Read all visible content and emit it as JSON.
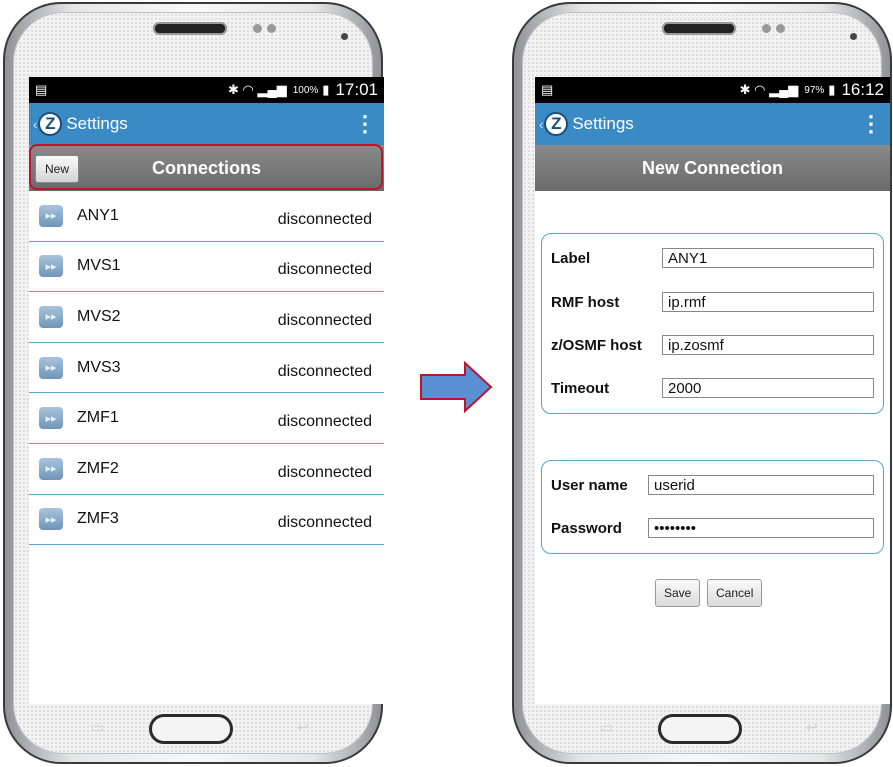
{
  "left_phone": {
    "status": {
      "battery": "100%",
      "time": "17:01"
    },
    "action_bar": {
      "title": "Settings"
    },
    "header": {
      "title": "Connections",
      "new_label": "New"
    },
    "connections": [
      {
        "label": "ANY1",
        "status": "disconnected"
      },
      {
        "label": "MVS1",
        "status": "disconnected"
      },
      {
        "label": "MVS2",
        "status": "disconnected"
      },
      {
        "label": "MVS3",
        "status": "disconnected"
      },
      {
        "label": "ZMF1",
        "status": "disconnected"
      },
      {
        "label": "ZMF2",
        "status": "disconnected"
      },
      {
        "label": "ZMF3",
        "status": "disconnected"
      }
    ]
  },
  "right_phone": {
    "status": {
      "battery": "97%",
      "time": "16:12"
    },
    "action_bar": {
      "title": "Settings"
    },
    "header": {
      "title": "New Connection"
    },
    "form": {
      "label_label": "Label",
      "label_value": "ANY1",
      "rmf_label": "RMF host",
      "rmf_value": "ip.rmf",
      "zosmf_label": "z/OSMF host",
      "zosmf_value": "ip.zosmf",
      "timeout_label": "Timeout",
      "timeout_value": "2000",
      "user_label": "User name",
      "user_value": "userid",
      "password_label": "Password",
      "password_value": "userpass"
    },
    "buttons": {
      "save": "Save",
      "cancel": "Cancel"
    }
  },
  "colors": {
    "action_bar": "#3a8bc5",
    "highlight": "#c0142a",
    "arrow_fill": "#5b8fd4",
    "arrow_stroke": "#c0142a"
  },
  "icons": [
    "back-chevron-icon",
    "z-logo-icon",
    "overflow-menu-icon",
    "bluetooth-icon",
    "wifi-icon",
    "signal-icon",
    "battery-icon",
    "connection-icon",
    "arrow-right-icon"
  ]
}
